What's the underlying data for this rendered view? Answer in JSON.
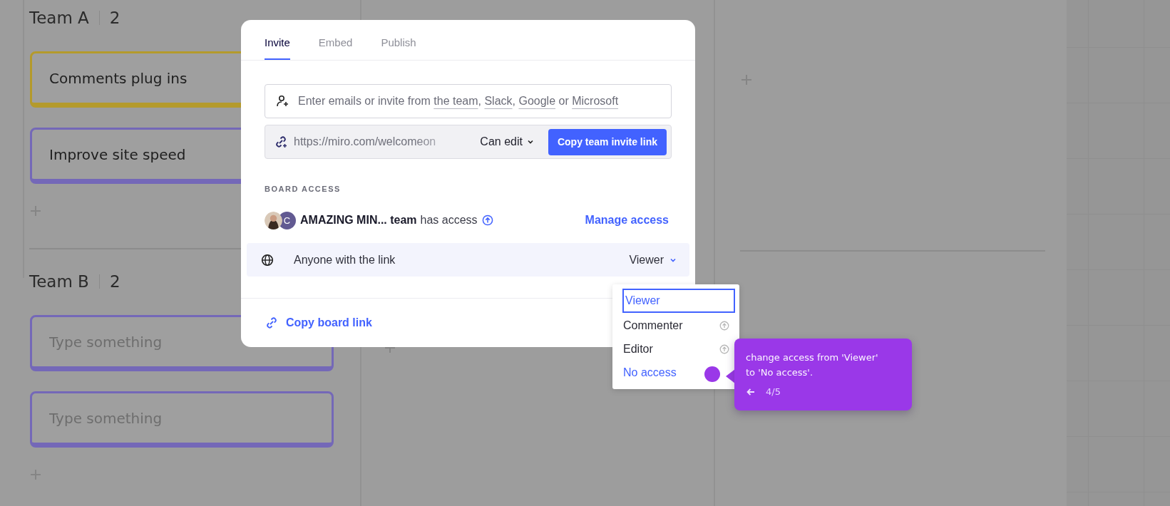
{
  "board": {
    "lanes": [
      {
        "title": "Team A",
        "count": "2",
        "cards": [
          {
            "kind": "note",
            "text": "Comments plug ins",
            "color": "#b49a2c"
          },
          {
            "kind": "note",
            "text": "Improve site speed",
            "color": "#7468b8"
          }
        ]
      },
      {
        "title": "Team B",
        "count": "2",
        "cards": [
          {
            "kind": "empty",
            "placeholder": "Type something",
            "color": "#7468b8"
          },
          {
            "kind": "empty",
            "placeholder": "Type something",
            "color": "#7468b8"
          }
        ]
      }
    ]
  },
  "dialog": {
    "tabs": [
      {
        "label": "Invite",
        "selected": true
      },
      {
        "label": "Embed",
        "selected": false
      },
      {
        "label": "Publish",
        "selected": false
      }
    ],
    "invite_field": {
      "hint": [
        {
          "kind": "text",
          "text": "Enter emails or invite from "
        },
        {
          "kind": "link",
          "text": "the team"
        },
        {
          "kind": "text",
          "text": ", "
        },
        {
          "kind": "link",
          "text": "Slack"
        },
        {
          "kind": "text",
          "text": ", "
        },
        {
          "kind": "link",
          "text": "Google"
        },
        {
          "kind": "text",
          "text": " or "
        },
        {
          "kind": "link",
          "text": "Microsoft"
        }
      ]
    },
    "invite_link": {
      "url": "https://miro.com/welcomeon",
      "permission": "Can edit",
      "button": "Copy team invite link"
    },
    "board_access": {
      "heading": "BOARD ACCESS",
      "avatar_initial": "C",
      "team_name": "AMAZING MIN... team",
      "team_suffix": "has access",
      "manage": "Manage access"
    },
    "link_access": {
      "label": "Anyone with the link",
      "role": "Viewer",
      "expanded": true
    },
    "copy_link": "Copy board link"
  },
  "role_menu": {
    "options": [
      {
        "label": "Viewer",
        "selected": true,
        "highlighted": false,
        "locked": false
      },
      {
        "label": "Commenter",
        "selected": false,
        "highlighted": false,
        "locked": true
      },
      {
        "label": "Editor",
        "selected": false,
        "highlighted": false,
        "locked": true
      },
      {
        "label": "No access",
        "selected": false,
        "highlighted": true,
        "locked": false
      }
    ]
  },
  "tour_tooltip": {
    "text": "change access from 'Viewer' to 'No access'.",
    "step": "4/5"
  }
}
